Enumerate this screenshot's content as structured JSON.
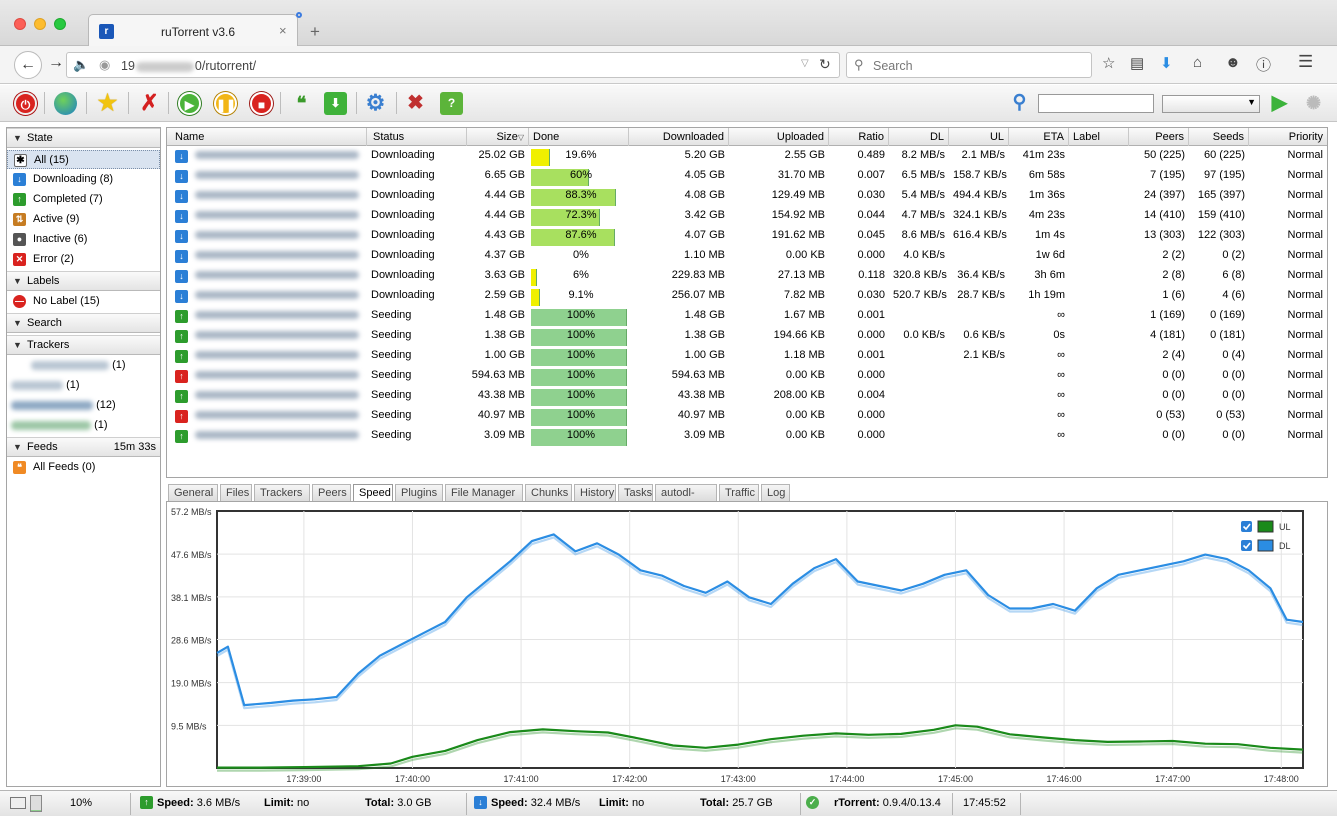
{
  "browser": {
    "tab_title": "ruTorrent v3.6",
    "tab_close": "×",
    "new_tab": "+",
    "url_prefix": "19",
    "url_suffix": "0/rutorrent/",
    "search_placeholder": "Search"
  },
  "sidebar": {
    "state_header": "State",
    "states": [
      {
        "label": "All (15)",
        "icon": "all-icon"
      },
      {
        "label": "Downloading (8)",
        "icon": "download-icon"
      },
      {
        "label": "Completed (7)",
        "icon": "completed-icon"
      },
      {
        "label": "Active (9)",
        "icon": "active-icon"
      },
      {
        "label": "Inactive (6)",
        "icon": "inactive-icon"
      },
      {
        "label": "Error (2)",
        "icon": "error-icon"
      }
    ],
    "labels_header": "Labels",
    "no_label": "No Label (15)",
    "search_header": "Search",
    "trackers_header": "Trackers",
    "trackers": [
      "(1)",
      "(1)",
      "(12)",
      "(1)"
    ],
    "feeds_header": "Feeds",
    "feeds_time": "15m 33s",
    "all_feeds": "All Feeds (0)"
  },
  "table": {
    "columns": [
      "Name",
      "Status",
      "Size",
      "Done",
      "Downloaded",
      "Uploaded",
      "Ratio",
      "DL",
      "UL",
      "ETA",
      "Label",
      "Peers",
      "Seeds",
      "Priority"
    ],
    "rows": [
      {
        "status": "Downloading",
        "size": "25.02 GB",
        "done": "19.6%",
        "pct": 19.6,
        "downloaded": "5.20 GB",
        "uploaded": "2.55 GB",
        "ratio": "0.489",
        "dl": "8.2 MB/s",
        "ul": "2.1 MB/s",
        "eta": "41m 23s",
        "peers": "50 (225)",
        "seeds": "60 (225)",
        "priority": "Normal",
        "kind": "down"
      },
      {
        "status": "Downloading",
        "size": "6.65 GB",
        "done": "60%",
        "pct": 60,
        "downloaded": "4.05 GB",
        "uploaded": "31.70 MB",
        "ratio": "0.007",
        "dl": "6.5 MB/s",
        "ul": "158.7 KB/s",
        "eta": "6m 58s",
        "peers": "7 (195)",
        "seeds": "97 (195)",
        "priority": "Normal",
        "kind": "down"
      },
      {
        "status": "Downloading",
        "size": "4.44 GB",
        "done": "88.3%",
        "pct": 88.3,
        "downloaded": "4.08 GB",
        "uploaded": "129.49 MB",
        "ratio": "0.030",
        "dl": "5.4 MB/s",
        "ul": "494.4 KB/s",
        "eta": "1m 36s",
        "peers": "24 (397)",
        "seeds": "165 (397)",
        "priority": "Normal",
        "kind": "down"
      },
      {
        "status": "Downloading",
        "size": "4.44 GB",
        "done": "72.3%",
        "pct": 72.3,
        "downloaded": "3.42 GB",
        "uploaded": "154.92 MB",
        "ratio": "0.044",
        "dl": "4.7 MB/s",
        "ul": "324.1 KB/s",
        "eta": "4m 23s",
        "peers": "14 (410)",
        "seeds": "159 (410)",
        "priority": "Normal",
        "kind": "down"
      },
      {
        "status": "Downloading",
        "size": "4.43 GB",
        "done": "87.6%",
        "pct": 87.6,
        "downloaded": "4.07 GB",
        "uploaded": "191.62 MB",
        "ratio": "0.045",
        "dl": "8.6 MB/s",
        "ul": "616.4 KB/s",
        "eta": "1m 4s",
        "peers": "13 (303)",
        "seeds": "122 (303)",
        "priority": "Normal",
        "kind": "down"
      },
      {
        "status": "Downloading",
        "size": "4.37 GB",
        "done": "0%",
        "pct": 0,
        "downloaded": "1.10 MB",
        "uploaded": "0.00 KB",
        "ratio": "0.000",
        "dl": "4.0 KB/s",
        "ul": "",
        "eta": "1w 6d",
        "peers": "2 (2)",
        "seeds": "0 (2)",
        "priority": "Normal",
        "kind": "down"
      },
      {
        "status": "Downloading",
        "size": "3.63 GB",
        "done": "6%",
        "pct": 6,
        "downloaded": "229.83 MB",
        "uploaded": "27.13 MB",
        "ratio": "0.118",
        "dl": "320.8 KB/s",
        "ul": "36.4 KB/s",
        "eta": "3h 6m",
        "peers": "2 (8)",
        "seeds": "6 (8)",
        "priority": "Normal",
        "kind": "down"
      },
      {
        "status": "Downloading",
        "size": "2.59 GB",
        "done": "9.1%",
        "pct": 9.1,
        "downloaded": "256.07 MB",
        "uploaded": "7.82 MB",
        "ratio": "0.030",
        "dl": "520.7 KB/s",
        "ul": "28.7 KB/s",
        "eta": "1h 19m",
        "peers": "1 (6)",
        "seeds": "4 (6)",
        "priority": "Normal",
        "kind": "down"
      },
      {
        "status": "Seeding",
        "size": "1.48 GB",
        "done": "100%",
        "pct": 100,
        "downloaded": "1.48 GB",
        "uploaded": "1.67 MB",
        "ratio": "0.001",
        "dl": "",
        "ul": "",
        "eta": "∞",
        "peers": "1 (169)",
        "seeds": "0 (169)",
        "priority": "Normal",
        "kind": "seed"
      },
      {
        "status": "Seeding",
        "size": "1.38 GB",
        "done": "100%",
        "pct": 100,
        "downloaded": "1.38 GB",
        "uploaded": "194.66 KB",
        "ratio": "0.000",
        "dl": "0.0 KB/s",
        "ul": "0.6 KB/s",
        "eta": "0s",
        "peers": "4 (181)",
        "seeds": "0 (181)",
        "priority": "Normal",
        "kind": "seed"
      },
      {
        "status": "Seeding",
        "size": "1.00 GB",
        "done": "100%",
        "pct": 100,
        "downloaded": "1.00 GB",
        "uploaded": "1.18 MB",
        "ratio": "0.001",
        "dl": "",
        "ul": "2.1 KB/s",
        "eta": "∞",
        "peers": "2 (4)",
        "seeds": "0 (4)",
        "priority": "Normal",
        "kind": "seed"
      },
      {
        "status": "Seeding",
        "size": "594.63 MB",
        "done": "100%",
        "pct": 100,
        "downloaded": "594.63 MB",
        "uploaded": "0.00 KB",
        "ratio": "0.000",
        "dl": "",
        "ul": "",
        "eta": "∞",
        "peers": "0 (0)",
        "seeds": "0 (0)",
        "priority": "Normal",
        "kind": "err"
      },
      {
        "status": "Seeding",
        "size": "43.38 MB",
        "done": "100%",
        "pct": 100,
        "downloaded": "43.38 MB",
        "uploaded": "208.00 KB",
        "ratio": "0.004",
        "dl": "",
        "ul": "",
        "eta": "∞",
        "peers": "0 (0)",
        "seeds": "0 (0)",
        "priority": "Normal",
        "kind": "seed"
      },
      {
        "status": "Seeding",
        "size": "40.97 MB",
        "done": "100%",
        "pct": 100,
        "downloaded": "40.97 MB",
        "uploaded": "0.00 KB",
        "ratio": "0.000",
        "dl": "",
        "ul": "",
        "eta": "∞",
        "peers": "0 (53)",
        "seeds": "0 (53)",
        "priority": "Normal",
        "kind": "err"
      },
      {
        "status": "Seeding",
        "size": "3.09 MB",
        "done": "100%",
        "pct": 100,
        "downloaded": "3.09 MB",
        "uploaded": "0.00 KB",
        "ratio": "0.000",
        "dl": "",
        "ul": "",
        "eta": "∞",
        "peers": "0 (0)",
        "seeds": "0 (0)",
        "priority": "Normal",
        "kind": "seed"
      }
    ]
  },
  "tabs": [
    "General",
    "Files",
    "Trackers",
    "Peers",
    "Speed",
    "Plugins",
    "File Manager",
    "Chunks",
    "History",
    "Tasks",
    "autodl-irssi",
    "Traffic",
    "Log"
  ],
  "active_tab": "Speed",
  "chart_data": {
    "type": "line",
    "y_ticks": [
      "57.2 MB/s",
      "47.6 MB/s",
      "38.1 MB/s",
      "28.6 MB/s",
      "19.0 MB/s",
      "9.5 MB/s"
    ],
    "x_ticks": [
      "17:39:00",
      "17:40:00",
      "17:41:00",
      "17:42:00",
      "17:43:00",
      "17:44:00",
      "17:45:00",
      "17:46:00",
      "17:47:00",
      "17:48:00"
    ],
    "ylim": [
      0,
      57.2
    ],
    "xlim_minutes": [
      38.2,
      48.2
    ],
    "series": [
      {
        "name": "UL",
        "color": "#1a8a1a",
        "x": [
          38.2,
          38.6,
          39.0,
          39.5,
          39.8,
          40.0,
          40.3,
          40.6,
          40.9,
          41.2,
          41.5,
          41.8,
          42.1,
          42.4,
          42.7,
          43.0,
          43.3,
          43.6,
          43.9,
          44.2,
          44.5,
          44.8,
          45.0,
          45.2,
          45.5,
          45.8,
          46.1,
          46.4,
          46.7,
          47.0,
          47.3,
          47.6,
          47.9,
          48.2
        ],
        "y": [
          0.1,
          0.1,
          0.2,
          0.4,
          1.0,
          2.5,
          3.8,
          6.2,
          8.0,
          8.6,
          8.2,
          7.9,
          6.5,
          5.0,
          4.5,
          5.2,
          6.4,
          7.2,
          7.7,
          7.4,
          7.6,
          8.5,
          9.5,
          9.2,
          7.5,
          6.8,
          6.2,
          5.8,
          5.9,
          6.0,
          5.4,
          5.3,
          4.5,
          4.1
        ]
      },
      {
        "name": "DL",
        "color": "#2b8de3",
        "x": [
          38.2,
          38.3,
          38.45,
          38.7,
          38.9,
          39.1,
          39.3,
          39.5,
          39.7,
          39.9,
          40.1,
          40.3,
          40.5,
          40.7,
          40.9,
          41.1,
          41.3,
          41.5,
          41.7,
          41.9,
          42.1,
          42.3,
          42.5,
          42.7,
          42.9,
          43.1,
          43.3,
          43.5,
          43.7,
          43.9,
          44.1,
          44.3,
          44.5,
          44.7,
          44.9,
          45.1,
          45.3,
          45.5,
          45.7,
          45.9,
          46.1,
          46.3,
          46.5,
          46.7,
          46.9,
          47.1,
          47.3,
          47.5,
          47.7,
          47.9,
          48.05,
          48.2
        ],
        "y": [
          25.6,
          27.0,
          14.0,
          14.5,
          15.0,
          15.3,
          15.8,
          21.0,
          25.0,
          27.5,
          30.0,
          32.5,
          38.0,
          42.0,
          46.0,
          50.5,
          52.0,
          48.2,
          50.0,
          47.5,
          44.0,
          42.8,
          40.5,
          39.0,
          41.5,
          38.0,
          36.5,
          41.0,
          44.5,
          46.5,
          41.5,
          40.5,
          39.5,
          41.0,
          43.0,
          44.0,
          38.5,
          35.5,
          35.5,
          36.5,
          35.0,
          40.0,
          43.0,
          44.0,
          45.0,
          46.0,
          47.5,
          46.5,
          44.0,
          40.0,
          33.0,
          32.5
        ]
      }
    ],
    "legend": [
      "UL",
      "DL"
    ],
    "legend_position": "top-right"
  },
  "status": {
    "percent": "10%",
    "ul_speed_label": "Speed:",
    "ul_speed": "3.6 MB/s",
    "ul_limit_label": "Limit:",
    "ul_limit": "no",
    "ul_total_label": "Total:",
    "ul_total": "3.0 GB",
    "dl_speed_label": "Speed:",
    "dl_speed": "32.4 MB/s",
    "dl_limit_label": "Limit:",
    "dl_limit": "no",
    "dl_total_label": "Total:",
    "dl_total": "25.7 GB",
    "client_label": "rTorrent:",
    "client_version": "0.9.4/0.13.4",
    "time": "17:45:52"
  }
}
